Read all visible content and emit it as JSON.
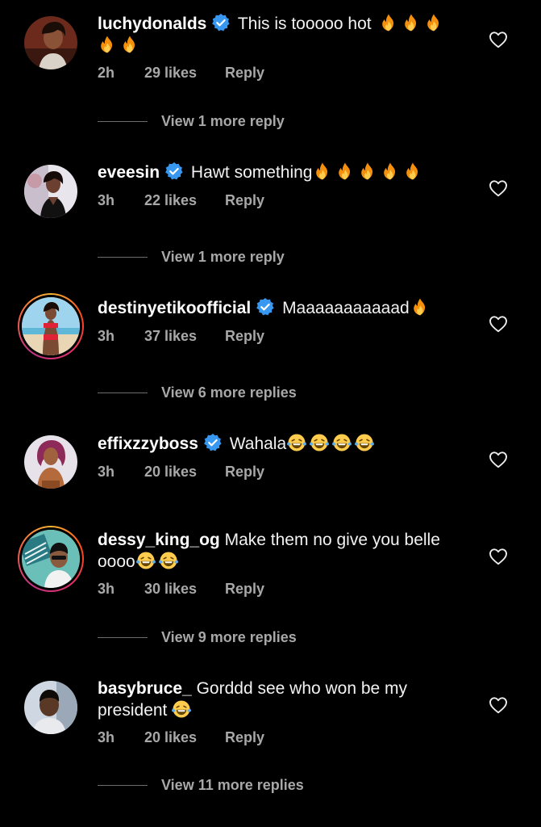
{
  "colors": {
    "background": "#000000",
    "username": "#ffffff",
    "meta": "#a8a8a8",
    "verified": "#3897f0",
    "story_ring": [
      "#f7b733",
      "#fc4a1a",
      "#e1306c",
      "#c13584"
    ]
  },
  "comments": [
    {
      "username": "luchydonalds",
      "verified": true,
      "story_ring": false,
      "text": "This is tooooo hot",
      "emojis": [
        "fire",
        "fire",
        "fire",
        "fire",
        "fire"
      ],
      "time": "2h",
      "likes": "29 likes",
      "reply": "Reply",
      "view_replies": "View 1 more reply"
    },
    {
      "username": "eveesin",
      "verified": true,
      "story_ring": false,
      "text": "Hawt something",
      "emojis": [
        "fire",
        "fire",
        "fire",
        "fire",
        "fire"
      ],
      "time": "3h",
      "likes": "22 likes",
      "reply": "Reply",
      "view_replies": "View 1 more reply"
    },
    {
      "username": "destinyetikoofficial",
      "verified": true,
      "story_ring": true,
      "text": "Maaaaaaaaaaad",
      "emojis": [
        "fire"
      ],
      "time": "3h",
      "likes": "37 likes",
      "reply": "Reply",
      "view_replies": "View 6 more replies"
    },
    {
      "username": "effixzzyboss",
      "verified": true,
      "story_ring": false,
      "text": "Wahala",
      "emojis": [
        "face-with-tears-of-joy",
        "face-with-tears-of-joy",
        "face-with-tears-of-joy",
        "face-with-tears-of-joy"
      ],
      "time": "3h",
      "likes": "20 likes",
      "reply": "Reply",
      "view_replies": ""
    },
    {
      "username": "dessy_king_og",
      "verified": false,
      "story_ring": true,
      "text": "Make them no give you belle oooo",
      "emojis": [
        "face-with-tears-of-joy",
        "face-with-tears-of-joy"
      ],
      "time": "3h",
      "likes": "30 likes",
      "reply": "Reply",
      "view_replies": "View 9 more replies"
    },
    {
      "username": "basybruce_",
      "verified": false,
      "story_ring": false,
      "text": "Gorddd see who won be my president",
      "emojis": [
        "face-with-tears-of-joy"
      ],
      "time": "3h",
      "likes": "20 likes",
      "reply": "Reply",
      "view_replies": "View 11 more replies"
    }
  ]
}
